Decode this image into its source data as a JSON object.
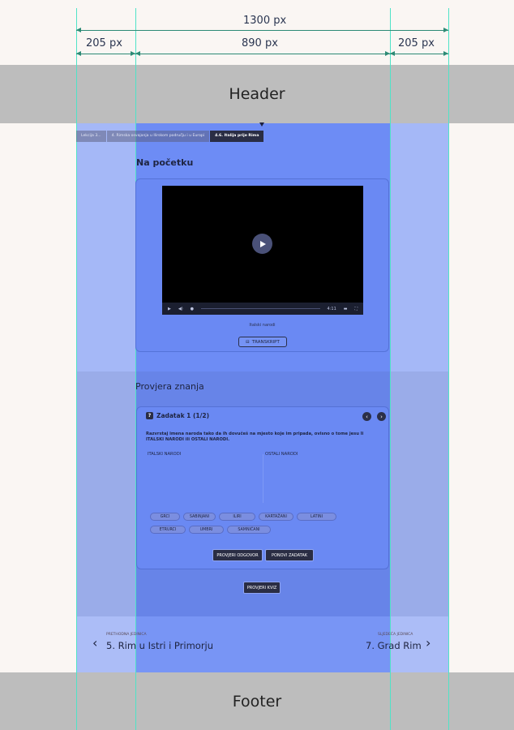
{
  "layout_labels": {
    "header": "Header",
    "footer": "Footer",
    "total_width": "1300 px",
    "left_margin": "205 px",
    "content_width": "890 px",
    "right_margin": "205 px"
  },
  "breadcrumb": [
    "Lekcija 3...",
    "4. Rimska osvajanja u Ilirskom području i u Europi",
    "4.6. Italija prije Rima"
  ],
  "intro": {
    "title": "Na početku",
    "caption": "Italski narodi",
    "transcript_label": "TRANSKRIPT",
    "player_time": "4:11"
  },
  "quiz": {
    "section_title": "Provjera znanja",
    "task_title": "Zadatak 1 (1/2)",
    "instruction": "Razvrstaj imena naroda tako da ih dovučeš na mjesto koje im pripada, ovisno o tome jesu li ITALSKI NARODI ili OSTALI NARODI.",
    "column_left": "ITALSKI NARODI",
    "column_right": "OSTALI NARODI",
    "chips": [
      "GRCI",
      "SABINJANI",
      "ILIRI",
      "KARTAŽANI",
      "LATINI",
      "ETRURCI",
      "UMBRI",
      "SAMNIĆANI"
    ],
    "check_label": "PROVJERI ODGOVOR",
    "retry_label": "PONOVI ZADATAK",
    "check_quiz_label": "PROVJERI KVIZ"
  },
  "page_nav": {
    "prev_label": "PRETHODNA JEDINICA",
    "prev_title": "5. Rim u Istri i Primorju",
    "next_label": "SLJEDEĆA JEDINICA",
    "next_title": "7. Grad Rim"
  }
}
